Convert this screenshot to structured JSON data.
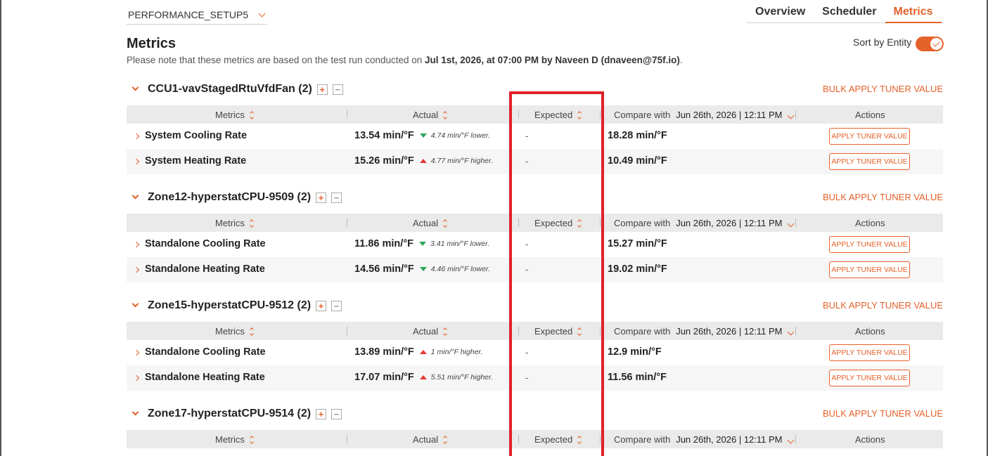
{
  "setup_select": {
    "value": "PERFORMANCE_SETUP5"
  },
  "nav": {
    "tabs": [
      "Overview",
      "Scheduler",
      "Metrics"
    ],
    "active": "Metrics"
  },
  "page": {
    "title": "Metrics",
    "note_prefix": "Please note that these metrics are based on the test run conducted on ",
    "note_bold": "Jul 1st, 2026, at 07:00 PM by Naveen D (dnaveen@75f.io)",
    "note_suffix": "."
  },
  "sort_toggle": {
    "label": "Sort by Entity",
    "on": true
  },
  "columns": {
    "metrics": "Metrics",
    "actual": "Actual",
    "expected": "Expected",
    "compare_with": "Compare with",
    "compare_date": "Jun 26th, 2026 | 12:11 PM",
    "actions": "Actions"
  },
  "bulk_label": "BULK APPLY TUNER VALUE",
  "apply_label": "APPLY TUNER VALUE",
  "groups": [
    {
      "title": "CCU1-vavStagedRtuVfdFan (2)",
      "rows": [
        {
          "name": "System Cooling Rate",
          "actual": "13.54 min/°F",
          "trend": "down",
          "diff": "4.74 min/°F lower.",
          "expected": "-",
          "compare": "18.28 min/°F"
        },
        {
          "name": "System Heating Rate",
          "actual": "15.26 min/°F",
          "trend": "up",
          "diff": "4.77 min/°F higher.",
          "expected": "-",
          "compare": "10.49 min/°F"
        }
      ]
    },
    {
      "title": "Zone12-hyperstatCPU-9509 (2)",
      "rows": [
        {
          "name": "Standalone Cooling Rate",
          "actual": "11.86 min/°F",
          "trend": "down",
          "diff": "3.41 min/°F lower.",
          "expected": "-",
          "compare": "15.27 min/°F"
        },
        {
          "name": "Standalone Heating Rate",
          "actual": "14.56 min/°F",
          "trend": "down",
          "diff": "4.46 min/°F lower.",
          "expected": "-",
          "compare": "19.02 min/°F"
        }
      ]
    },
    {
      "title": "Zone15-hyperstatCPU-9512 (2)",
      "rows": [
        {
          "name": "Standalone Cooling Rate",
          "actual": "13.89 min/°F",
          "trend": "up",
          "diff": "1 min/°F higher.",
          "expected": "-",
          "compare": "12.9 min/°F"
        },
        {
          "name": "Standalone Heating Rate",
          "actual": "17.07 min/°F",
          "trend": "up",
          "diff": "5.51 min/°F higher.",
          "expected": "-",
          "compare": "11.56 min/°F"
        }
      ]
    },
    {
      "title": "Zone17-hyperstatCPU-9514 (2)",
      "rows": []
    }
  ],
  "colors": {
    "accent": "#e5612a",
    "highlight": "#e02128",
    "down": "#2aa558",
    "up": "#e53935"
  }
}
